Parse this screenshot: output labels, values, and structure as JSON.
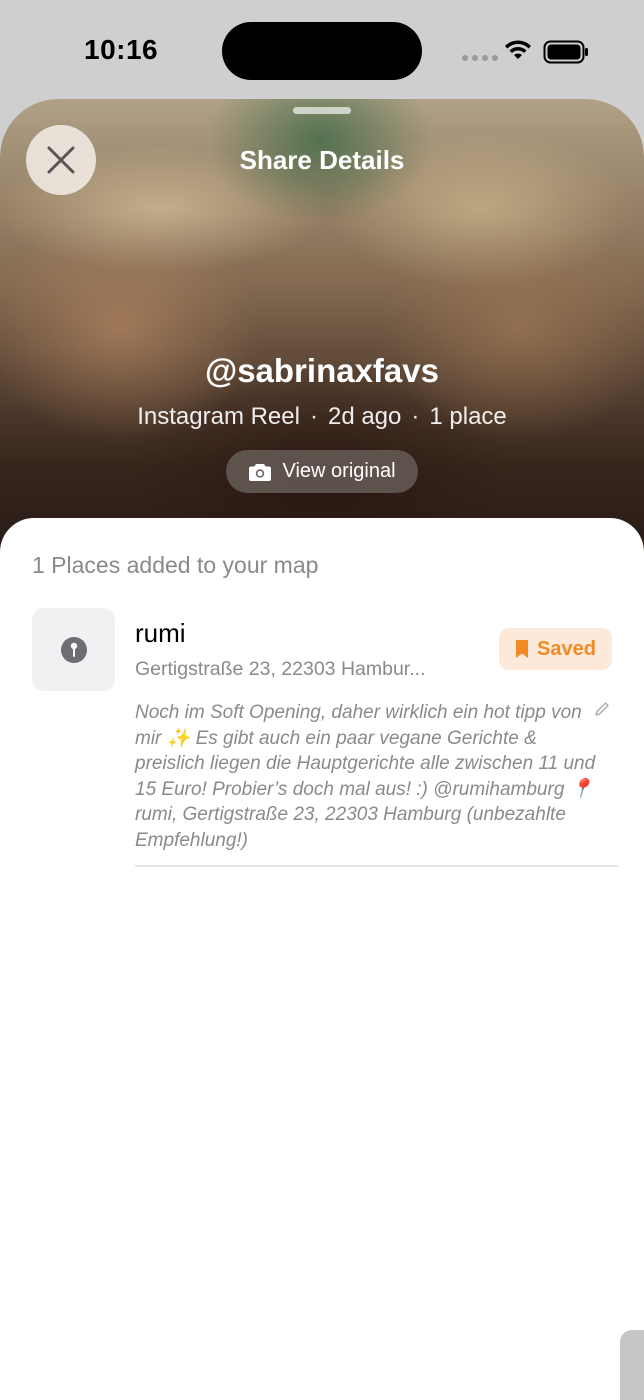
{
  "status_bar": {
    "time": "10:16"
  },
  "sheet": {
    "title": "Share Details",
    "handle": "@sabrinaxfavs",
    "meta": {
      "source": "Instagram Reel",
      "age": "2d ago",
      "count": "1 place",
      "separator": "·"
    },
    "view_original_label": "View original"
  },
  "places": {
    "heading": "1 Places added to your map",
    "items": [
      {
        "name": "rumi",
        "address": "Gertigstraße 23, 22303 Hambur...",
        "status_label": "Saved",
        "note": "Noch im Soft Opening, daher wirklich ein hot tipp von mir ✨ Es gibt auch ein paar vegane Gerichte & preislich liegen die Hauptgerichte alle zwischen 11 und 15 Euro! Probier’s doch mal aus! :) @rumihamburg 📍rumi, Gertigstraße 23, 22303 Hamburg (unbezahlte Empfehlung!)"
      }
    ]
  },
  "colors": {
    "accent": "#f08a24",
    "badge_bg": "#fde9d9",
    "muted_text": "#8a8a8e"
  },
  "icons": [
    "close-icon",
    "camera-icon",
    "pin-icon",
    "bookmark-icon",
    "pencil-icon",
    "wifi-icon",
    "battery-icon"
  ]
}
